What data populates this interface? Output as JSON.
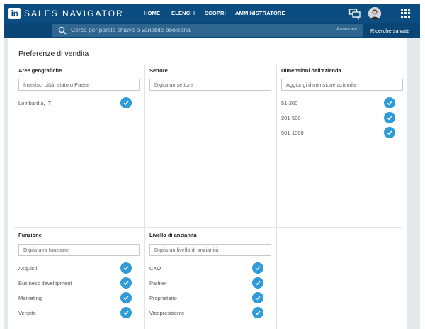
{
  "header": {
    "logo_text": "in",
    "brand": "SALES NAVIGATOR",
    "nav": [
      "HOME",
      "ELENCHI",
      "SCOPRI",
      "AMMINISTRATORE"
    ],
    "icons": {
      "messages": "chat-icon",
      "apps": "grid-icon"
    },
    "color": "#0b4d80"
  },
  "search": {
    "placeholder": "Cerca per parole chiave o variabile booleana",
    "advanced": "Avanzata",
    "saved_searches": "Ricerche salvate"
  },
  "page": {
    "title": "Preferenze di vendita"
  },
  "sections": {
    "geo": {
      "title": "Aree geografiche",
      "placeholder": "Inserisci città, stato o Paese",
      "items": [
        "Lombardia, IT"
      ]
    },
    "sector": {
      "title": "Settore",
      "placeholder": "Digita un settore",
      "items": []
    },
    "size": {
      "title": "Dimensioni dell'azienda",
      "placeholder": "Aggiungi dimensione azienda",
      "items": [
        "51-200",
        "201-500",
        "501-1000"
      ]
    },
    "function": {
      "title": "Funzione",
      "placeholder": "Digita una funzione",
      "items": [
        "Acquisti",
        "Business development",
        "Marketing",
        "Vendite"
      ]
    },
    "seniority": {
      "title": "Livello di anzianità",
      "placeholder": "Digita un livello di anzianità",
      "items": [
        "CXO",
        "Partner",
        "Proprietario",
        "Vicepresidente"
      ]
    }
  },
  "accent_color": "#2f9bd9"
}
